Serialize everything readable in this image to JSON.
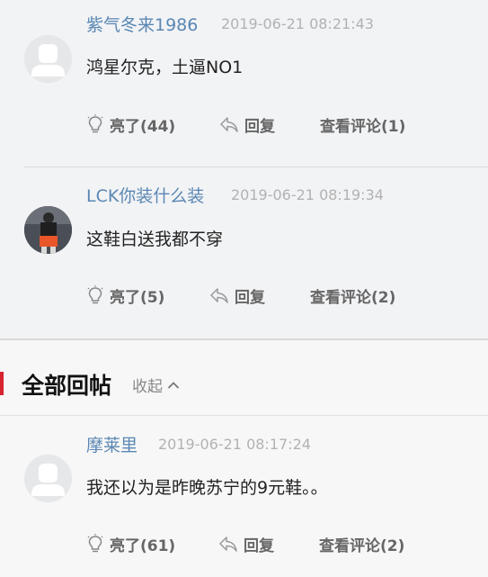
{
  "comments": [
    {
      "username": "紫气冬来1986",
      "time": "2019-06-21 08:21:43",
      "content": "鸿星尔克，土逼NO1",
      "like_label": "亮了(44)",
      "reply_label": "回复",
      "view_label": "查看评论(1)"
    },
    {
      "username": "LCK你装什么装",
      "time": "2019-06-21 08:19:34",
      "content": "这鞋白送我都不穿",
      "like_label": "亮了(5)",
      "reply_label": "回复",
      "view_label": "查看评论(2)"
    }
  ],
  "all_replies": {
    "title": "全部回帖",
    "collapse_label": "收起",
    "accent_color": "#d6232e"
  },
  "reply": {
    "username": "摩莱里",
    "time": "2019-06-21 08:17:24",
    "content": "我还以为是昨晚苏宁的9元鞋。。",
    "like_label": "亮了(61)",
    "reply_label": "回复",
    "view_label": "查看评论(2)"
  },
  "colors": {
    "username": "#5a87b3",
    "timestamp": "#b2b2b2",
    "action_text": "#666666"
  },
  "icons": [
    "avatar-placeholder-icon",
    "lightbulb-icon",
    "reply-arrow-icon",
    "chevron-up-icon"
  ]
}
